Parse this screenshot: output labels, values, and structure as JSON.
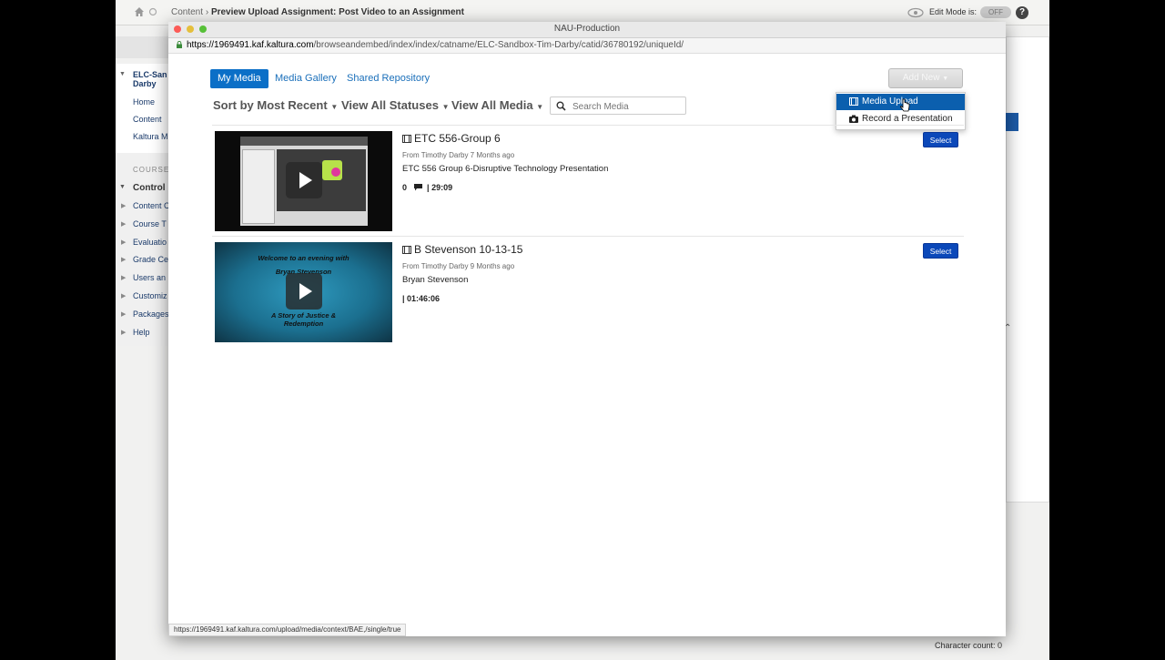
{
  "blackboard": {
    "breadcrumb_prefix": "Content",
    "breadcrumb_sep": "›",
    "breadcrumb_title": "Preview Upload Assignment: Post Video to an Assignment",
    "edit_mode_label": "Edit Mode is:",
    "edit_mode_value": "OFF",
    "help_label": "?",
    "course_name": "ELC-San",
    "course_name2": "Darby",
    "nav": [
      "Home",
      "Content",
      "Kaltura M"
    ],
    "course_mgmt_label": "COURSE",
    "control_panel_label": "Control",
    "control_items": [
      "Content C",
      "Course T",
      "Evaluatio",
      "Grade Ce",
      "Users an",
      "Customiz",
      "Packages",
      "Help"
    ],
    "char_count": "Character count: 0"
  },
  "modal": {
    "window_title": "NAU-Production",
    "url_domain": "https://1969491.kaf.kaltura.com",
    "url_path": "/browseandembed/index/index/catname/ELC-Sandbox-Tim-Darby/catid/36780192/uniqueId/",
    "tabs": [
      "My Media",
      "Media Gallery",
      "Shared Repository"
    ],
    "filters": [
      "Sort by Most Recent",
      "View All Statuses",
      "View All Media"
    ],
    "search_placeholder": "Search Media",
    "add_new_label": "Add New",
    "dropdown": [
      "Media Upload",
      "Record a Presentation"
    ],
    "entries": [
      {
        "title": "ETC 556-Group 6",
        "meta": "From Timothy Darby 7 Months ago",
        "description": "ETC 556 Group 6-Disruptive Technology Presentation",
        "comments": "0",
        "duration": "| 29:09",
        "select_label": "Select"
      },
      {
        "title": "B Stevenson 10-13-15",
        "meta": "From Timothy Darby 9 Months ago",
        "description": "Bryan Stevenson",
        "duration": "| 01:46:06",
        "select_label": "Select",
        "thumb_text1": "Welcome to an evening with",
        "thumb_text2": "Bryan Stevenson",
        "thumb_text3": "A Story of Justice &",
        "thumb_text4": "Redemption"
      }
    ],
    "status_url": "https://1969491.kaf.kaltura.com/upload/media/context/BAE,/single/true"
  }
}
